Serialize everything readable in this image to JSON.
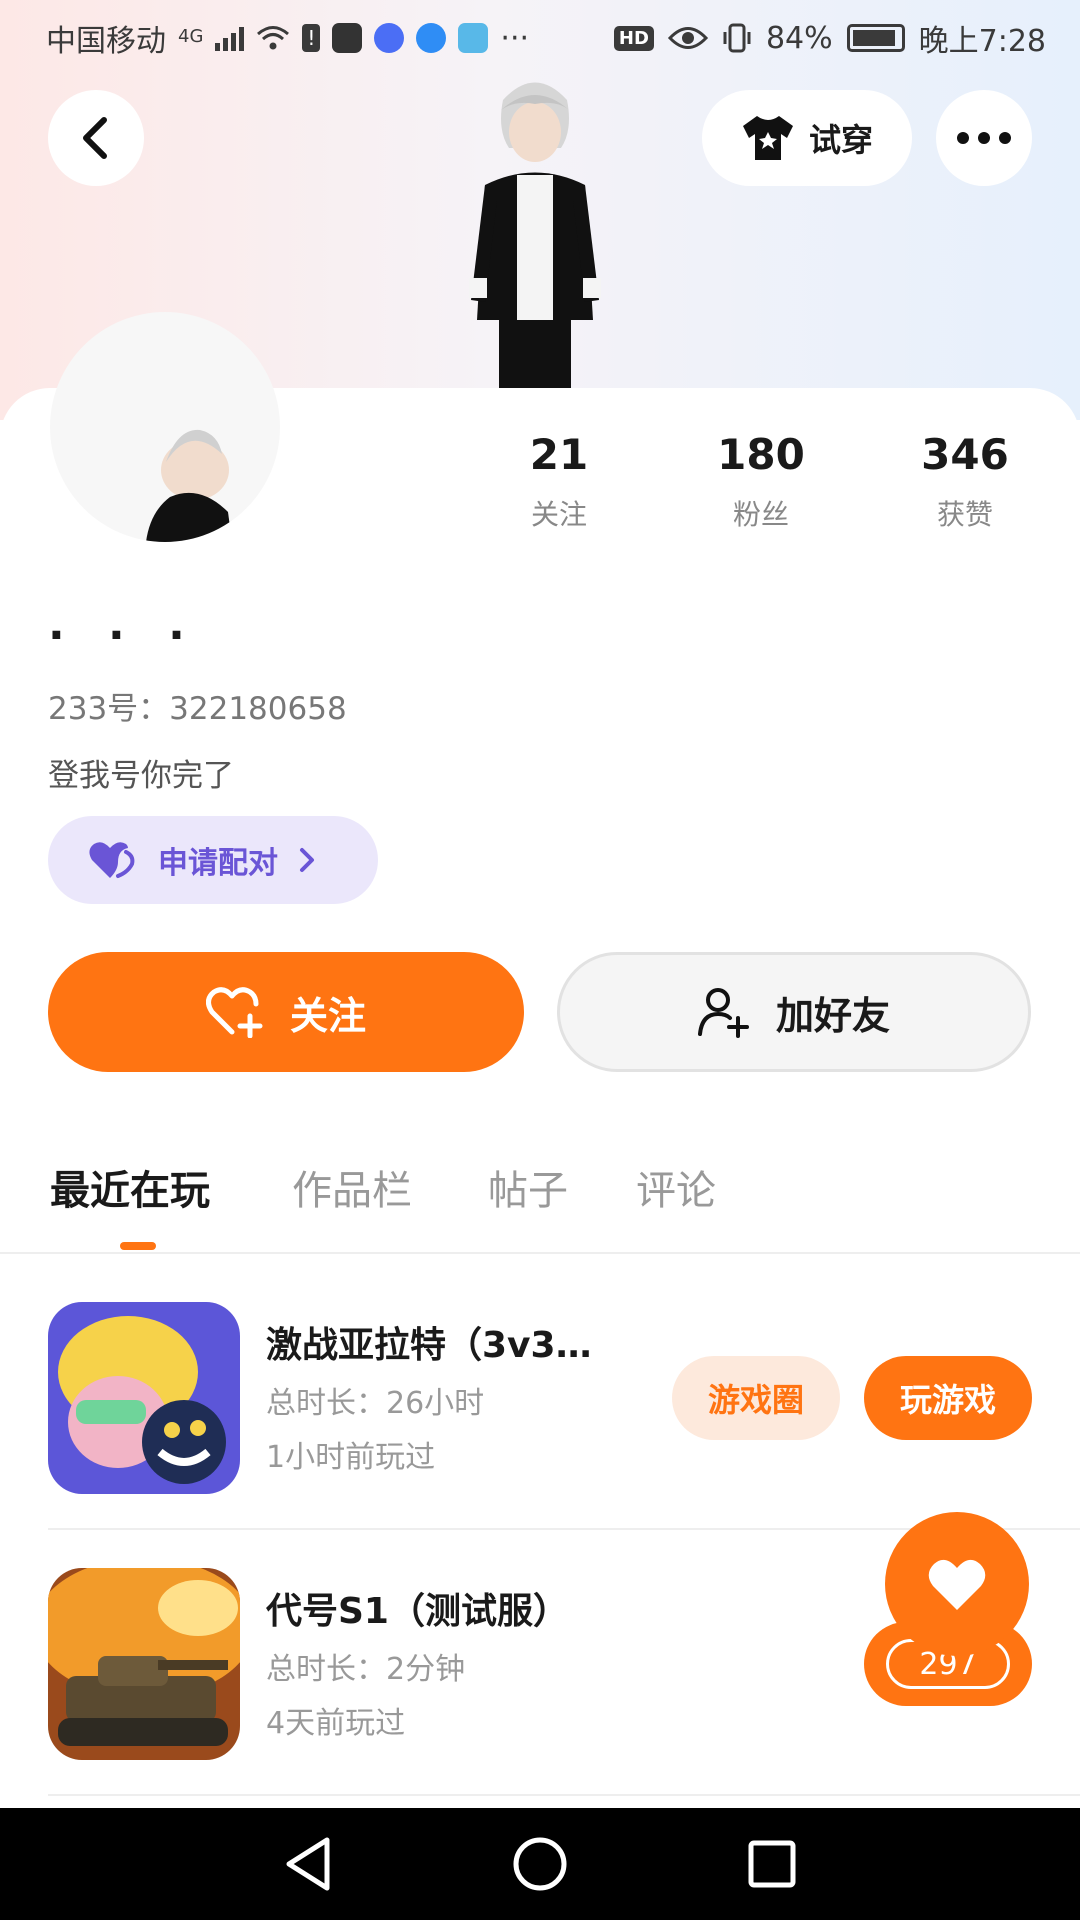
{
  "status_bar": {
    "carrier": "中国移动",
    "network": "4G",
    "more": "···",
    "hd": "HD",
    "battery": "84%",
    "time": "晚上7:28"
  },
  "header": {
    "tryon_label": "试穿"
  },
  "profile": {
    "stats": [
      {
        "value": "21",
        "label": "关注"
      },
      {
        "value": "180",
        "label": "粉丝"
      },
      {
        "value": "346",
        "label": "获赞"
      }
    ],
    "nickname": "· · ·",
    "uid": "233号：322180658",
    "bio": "登我号你完了",
    "pair_label": "申请配对"
  },
  "actions": {
    "follow_label": "关注",
    "add_friend_label": "加好友"
  },
  "tabs": [
    "最近在玩",
    "作品栏",
    "帖子",
    "评论"
  ],
  "games": [
    {
      "title": "激战亚拉特（3v3…",
      "duration": "总时长：26小时",
      "last_played": "1小时前玩过",
      "circle_label": "游戏圈",
      "play_label": "玩游戏"
    },
    {
      "title": "代号S1（测试服）",
      "duration": "总时长：2分钟",
      "last_played": "4天前玩过"
    }
  ],
  "like_fab": {
    "count": "297"
  },
  "colors": {
    "accent": "#ff7412",
    "pair_purple": "#6a55d6"
  }
}
